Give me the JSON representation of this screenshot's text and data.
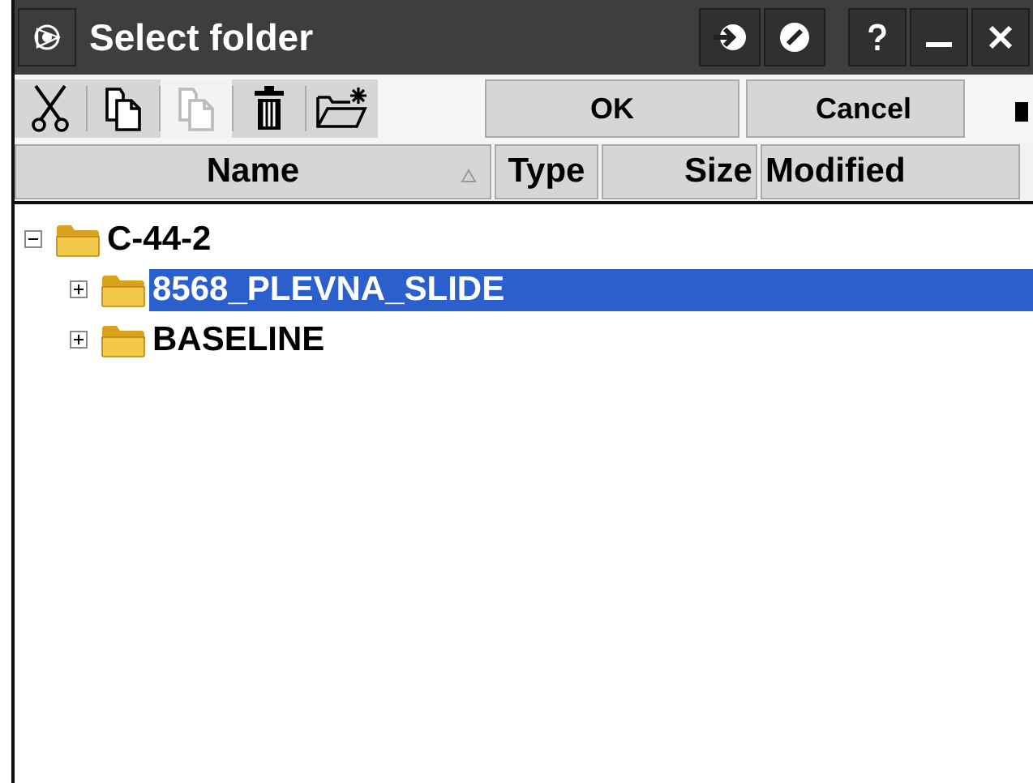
{
  "window": {
    "title": "Select folder"
  },
  "toolbar": [
    {
      "kind": "cut",
      "disabled": false
    },
    {
      "kind": "copy",
      "disabled": false
    },
    {
      "kind": "paste",
      "disabled": true
    },
    {
      "kind": "delete",
      "disabled": false
    },
    {
      "kind": "new-folder",
      "disabled": false
    }
  ],
  "buttons": [
    "OK",
    "Cancel"
  ],
  "columns": [
    {
      "label": "Name",
      "sorted": true
    },
    {
      "label": "Type",
      "sorted": false
    },
    {
      "label": "Size",
      "sorted": false
    },
    {
      "label": "Modified",
      "sorted": false
    }
  ],
  "tree": [
    {
      "label": "C-44-2",
      "expanded": true,
      "selected": false,
      "children": [
        {
          "label": "8568_PLEVNA_SLIDE",
          "expanded": false,
          "selected": true
        },
        {
          "label": "BASELINE",
          "expanded": false,
          "selected": false
        }
      ]
    }
  ]
}
